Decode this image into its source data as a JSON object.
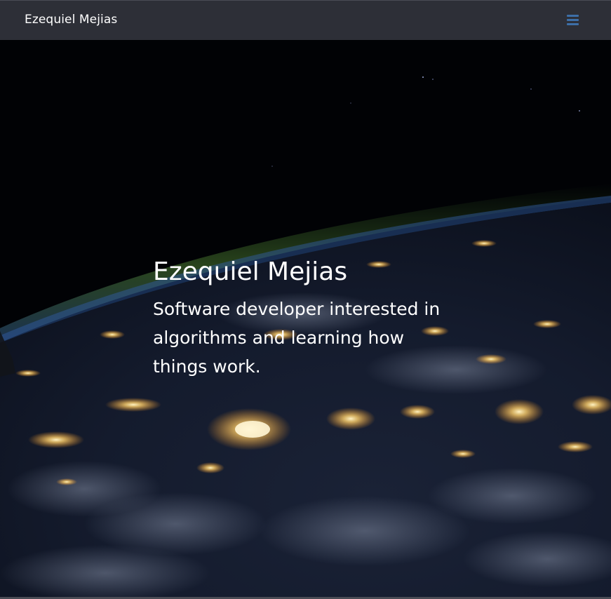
{
  "navbar": {
    "brand": "Ezequiel Mejias",
    "menu_icon": "hamburger-menu-icon",
    "background": "#2d2f37",
    "menu_icon_color": "#3d6fa8"
  },
  "hero": {
    "title": "Ezequiel Mejias",
    "subtitle": "Software developer interested in algorithms and learning how things work.",
    "background_image": "earth-at-night-from-space"
  }
}
